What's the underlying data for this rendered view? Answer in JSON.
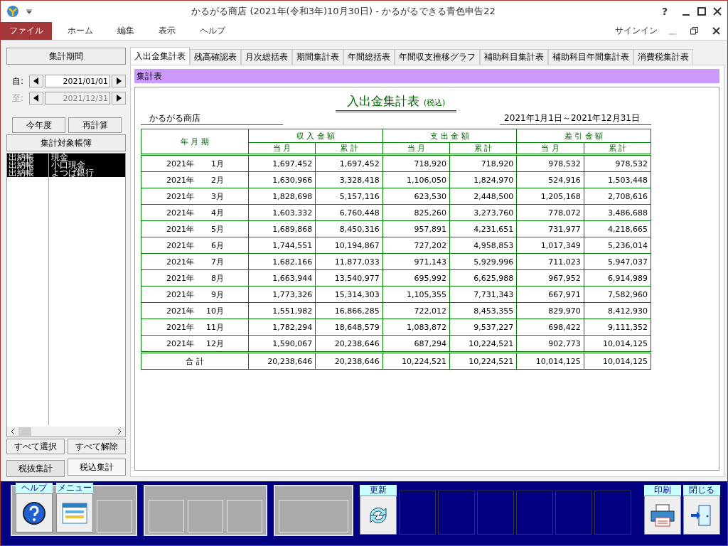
{
  "window": {
    "title": "かるがる商店 (2021年(令和3年)10月30日) - かるがるできる青色申告22",
    "help": "?"
  },
  "menu": {
    "items": [
      {
        "label": "ファイル",
        "selected": true
      },
      {
        "label": "ホーム",
        "selected": false
      },
      {
        "label": "編集",
        "selected": false
      },
      {
        "label": "表示",
        "selected": false
      },
      {
        "label": "ヘルプ",
        "selected": false
      }
    ],
    "signin": "サインイン"
  },
  "sidebar": {
    "period_header": "集計期間",
    "dates": [
      {
        "label": "自:",
        "value": "2021/01/01",
        "disabled": false
      },
      {
        "label": "至:",
        "value": "2021/12/31",
        "disabled": true
      }
    ],
    "period_buttons": [
      "今年度",
      "再計算"
    ],
    "ledger_header": "集計対象帳簿",
    "ledgers": [
      {
        "book": "出納帳",
        "account": "現金",
        "selected": true
      },
      {
        "book": "出納帳",
        "account": "小口現金",
        "selected": true
      },
      {
        "book": "出納帳",
        "account": "よつば銀行",
        "selected": true
      }
    ],
    "select_buttons": [
      "すべて選択",
      "すべて解除"
    ],
    "tax_tabs": [
      {
        "label": "税抜集計",
        "selected": false
      },
      {
        "label": "税込集計",
        "selected": true
      }
    ]
  },
  "tabs": [
    {
      "label": "入出金集計表",
      "selected": true
    },
    {
      "label": "残高確認表",
      "selected": false
    },
    {
      "label": "月次総括表",
      "selected": false
    },
    {
      "label": "期間集計表",
      "selected": false
    },
    {
      "label": "年間総括表",
      "selected": false
    },
    {
      "label": "年間収支推移グラフ",
      "selected": false
    },
    {
      "label": "補助科目集計表",
      "selected": false
    },
    {
      "label": "補助科目年間集計表",
      "selected": false
    },
    {
      "label": "消費税集計表",
      "selected": false
    }
  ],
  "section_bar": "集計表",
  "report": {
    "title": "入出金集計表",
    "subtitle": "(税込)",
    "company": "かるがる商店",
    "range": "2021年1月1日～2021年12月31日",
    "period_column": "年 月 期",
    "groups": [
      "収 入 金 額",
      "支 出 金 額",
      "差 引 金 額"
    ],
    "subcolumns": [
      "当 月",
      "累 計",
      "当 月",
      "累 計",
      "当 月",
      "累 計"
    ],
    "rows": [
      {
        "year": "2021年",
        "month": "1月",
        "values": [
          "1,697,452",
          "1,697,452",
          "718,920",
          "718,920",
          "978,532",
          "978,532"
        ]
      },
      {
        "year": "2021年",
        "month": "2月",
        "values": [
          "1,630,966",
          "3,328,418",
          "1,106,050",
          "1,824,970",
          "524,916",
          "1,503,448"
        ]
      },
      {
        "year": "2021年",
        "month": "3月",
        "values": [
          "1,828,698",
          "5,157,116",
          "623,530",
          "2,448,500",
          "1,205,168",
          "2,708,616"
        ]
      },
      {
        "year": "2021年",
        "month": "4月",
        "values": [
          "1,603,332",
          "6,760,448",
          "825,260",
          "3,273,760",
          "778,072",
          "3,486,688"
        ]
      },
      {
        "year": "2021年",
        "month": "5月",
        "values": [
          "1,689,868",
          "8,450,316",
          "957,891",
          "4,231,651",
          "731,977",
          "4,218,665"
        ]
      },
      {
        "year": "2021年",
        "month": "6月",
        "values": [
          "1,744,551",
          "10,194,867",
          "727,202",
          "4,958,853",
          "1,017,349",
          "5,236,014"
        ]
      },
      {
        "year": "2021年",
        "month": "7月",
        "values": [
          "1,682,166",
          "11,877,033",
          "971,143",
          "5,929,996",
          "711,023",
          "5,947,037"
        ]
      },
      {
        "year": "2021年",
        "month": "8月",
        "values": [
          "1,663,944",
          "13,540,977",
          "695,992",
          "6,625,988",
          "967,952",
          "6,914,989"
        ]
      },
      {
        "year": "2021年",
        "month": "9月",
        "values": [
          "1,773,326",
          "15,314,303",
          "1,105,355",
          "7,731,343",
          "667,971",
          "7,582,960"
        ]
      },
      {
        "year": "2021年",
        "month": "10月",
        "values": [
          "1,551,982",
          "16,866,285",
          "722,012",
          "8,453,355",
          "829,970",
          "8,412,930"
        ]
      },
      {
        "year": "2021年",
        "month": "11月",
        "values": [
          "1,782,294",
          "18,648,579",
          "1,083,872",
          "9,537,227",
          "698,422",
          "9,111,352"
        ]
      },
      {
        "year": "2021年",
        "month": "12月",
        "values": [
          "1,590,067",
          "20,238,646",
          "687,294",
          "10,224,521",
          "902,773",
          "10,014,125"
        ]
      }
    ],
    "total": {
      "label": "合 計",
      "values": [
        "20,238,646",
        "20,238,646",
        "10,224,521",
        "10,224,521",
        "10,014,125",
        "10,014,125"
      ]
    }
  },
  "toolbar": {
    "groups": [
      {
        "kind": "light",
        "buttons": [
          {
            "kind": "help",
            "label": "ヘルプ"
          },
          {
            "kind": "menu",
            "label": "メニュー"
          },
          {
            "kind": "empty"
          }
        ]
      },
      {
        "kind": "light",
        "buttons": [
          {
            "kind": "empty"
          },
          {
            "kind": "empty"
          },
          {
            "kind": "empty"
          }
        ]
      },
      {
        "kind": "light",
        "buttons": [
          {
            "kind": "wide"
          }
        ]
      },
      {
        "kind": "dark",
        "buttons": [
          {
            "kind": "refresh",
            "label": "更新"
          },
          {
            "kind": "slot"
          },
          {
            "kind": "slot"
          },
          {
            "kind": "slot"
          },
          {
            "kind": "slot"
          },
          {
            "kind": "slot"
          },
          {
            "kind": "slot"
          }
        ]
      },
      {
        "kind": "dark",
        "buttons": [
          {
            "kind": "print",
            "label": "印刷"
          },
          {
            "kind": "close",
            "label": "閉じる"
          }
        ]
      }
    ]
  }
}
